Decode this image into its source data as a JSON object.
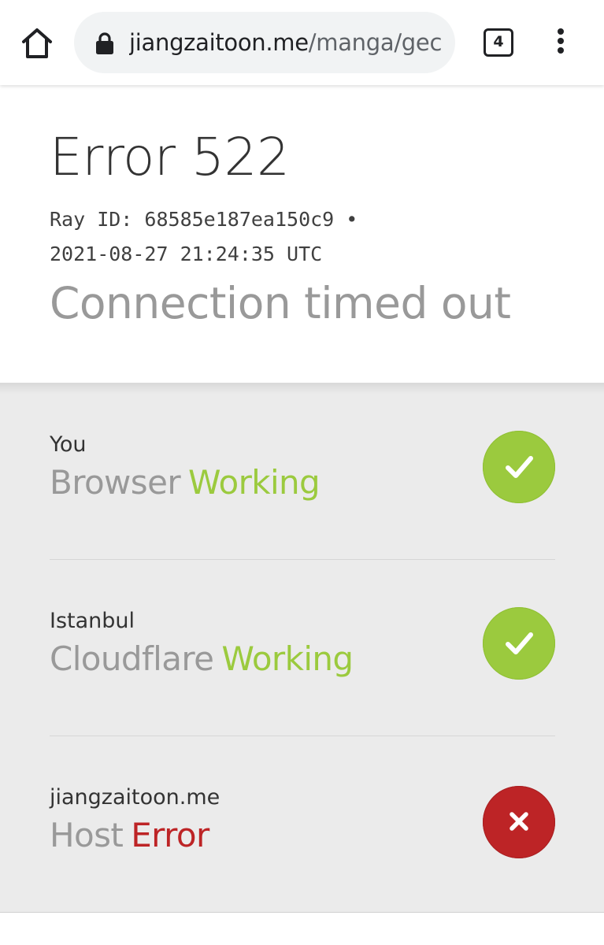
{
  "browser": {
    "url_host": "jiangzaitoon.me",
    "url_path": "/manga/gec",
    "tab_count": "4",
    "icons": {
      "home": "home-icon",
      "lock": "lock-icon",
      "tabs": "tab-switcher-icon",
      "menu": "more-vert-icon"
    }
  },
  "error": {
    "title": "Error 522",
    "ray_line_1": "Ray ID: 68585e187ea150c9 •",
    "ray_line_2": "2021-08-27 21:24:35 UTC",
    "subtitle": "Connection timed out"
  },
  "status_rows": [
    {
      "location": "You",
      "name": "Browser",
      "status": "Working",
      "state": "ok",
      "icon": "checkmark-icon",
      "color": "#9bca3e"
    },
    {
      "location": "Istanbul",
      "name": "Cloudflare",
      "status": "Working",
      "state": "ok",
      "icon": "checkmark-icon",
      "color": "#9bca3e"
    },
    {
      "location": "jiangzaitoon.me",
      "name": "Host",
      "status": "Error",
      "state": "error",
      "icon": "x-icon",
      "color": "#bd2426"
    }
  ],
  "colors": {
    "working_green": "#9bca3e",
    "error_red": "#bd2426",
    "panel_gray": "#ebebeb",
    "muted_text": "#999999"
  }
}
